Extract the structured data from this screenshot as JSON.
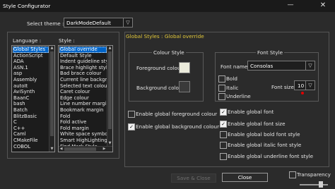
{
  "window": {
    "title": "Style Configurator",
    "minimize": "—",
    "close": "✕"
  },
  "theme": {
    "label": "Select theme :",
    "value": "DarkModeDefault",
    "arrow": "▽"
  },
  "language": {
    "label": "Language :",
    "items": [
      "Global Styles",
      "ActionScript",
      "ADA",
      "ASN.1",
      "asp",
      "Assembly",
      "autoIt",
      "AviSynth",
      "BaanC",
      "bash",
      "Batch",
      "BlitzBasic",
      "C",
      "C++",
      "Caml",
      "CMakeFile",
      "COBOL"
    ],
    "selected_index": 0
  },
  "style": {
    "label": "Style :",
    "items": [
      "Global override",
      "Default Style",
      "Indent guideline style",
      "Brace highlight style",
      "Bad brace colour",
      "Current line background",
      "Selected text colour",
      "Caret colour",
      "Edge colour",
      "Line number margin",
      "Bookmark margin",
      "Fold",
      "Fold active",
      "Fold margin",
      "White space symbol",
      "Smart HighLighting",
      "Find Mark Style",
      "Mark Style 1"
    ],
    "selected_index": 0
  },
  "header": "Global Styles : Global override",
  "colour_style": {
    "legend": "Colour Style",
    "fg_label": "Foreground colour",
    "bg_label": "Background colour",
    "fg_color": "#ececdc",
    "bg_color": "#3a3a3a"
  },
  "font_style": {
    "legend": "Font Style",
    "font_name_label": "Font name :",
    "font_name": "Consolas",
    "bold": "Bold",
    "italic": "Italic",
    "underline": "Underline",
    "font_size_label": "Font size :",
    "font_size": "10",
    "arrow": "▽"
  },
  "options_left": [
    {
      "label": "Enable global foreground colour",
      "checked": false
    },
    {
      "label": "Enable global background colour",
      "checked": true
    }
  ],
  "options_right": [
    {
      "label": "Enable global font",
      "checked": true
    },
    {
      "label": "Enable global font size",
      "checked": true
    },
    {
      "label": "Enable global bold font style",
      "checked": false
    },
    {
      "label": "Enable global italic font style",
      "checked": false
    },
    {
      "label": "Enable global underline font style",
      "checked": false
    }
  ],
  "buttons": {
    "save": "Save & Close",
    "close": "Close"
  },
  "transparency": {
    "label": "Transparency",
    "checked": false
  }
}
